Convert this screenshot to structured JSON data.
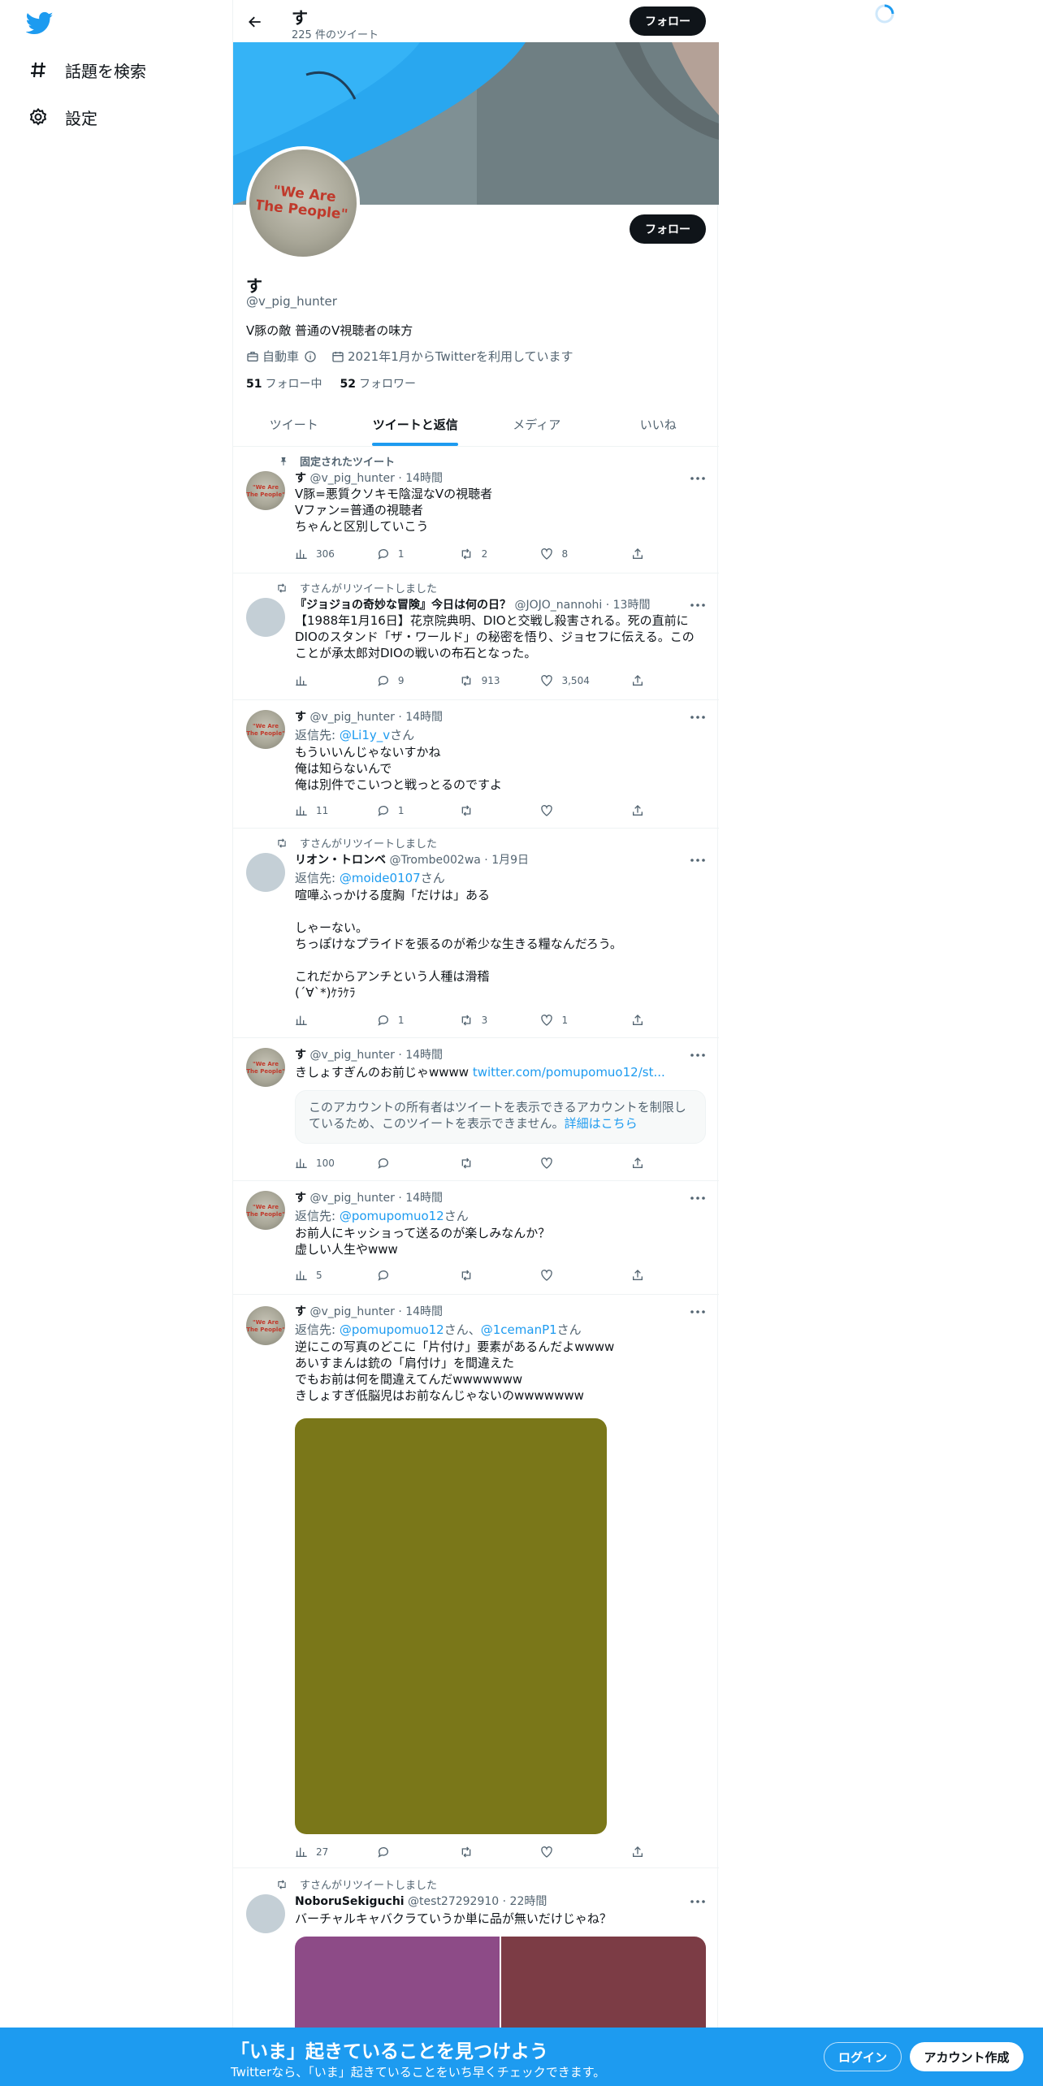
{
  "nav": {
    "logo_icon": "twitter-bird-icon",
    "explore_label": "話題を検索",
    "settings_label": "設定"
  },
  "header": {
    "title": "す",
    "tweet_count": "225 件のツイート",
    "follow_label": "フォロー"
  },
  "profile": {
    "name": "す",
    "handle": "@v_pig_hunter",
    "bio": "V豚の敵 普通のV視聴者の味方",
    "category": "自動車",
    "joined": "2021年1月からTwitterを利用しています",
    "following_count": "51",
    "following_label": "フォロー中",
    "followers_count": "52",
    "followers_label": "フォロワー",
    "follow_label": "フォロー"
  },
  "tabs": [
    "ツイート",
    "ツイートと返信",
    "メディア",
    "いいね"
  ],
  "tweets": [
    {
      "context": "固定されたツイート",
      "name": "す",
      "meta": "@v_pig_hunter · 14時間",
      "body": "V豚=悪質クソキモ陰湿なVの視聴者\nVファン=普通の視聴者\nちゃんと区別していこう",
      "views": "306",
      "replies": "1",
      "retweets": "2",
      "likes": "8"
    },
    {
      "context": "すさんがリツイートしました",
      "name": "『ジョジョの奇妙な冒険』今日は何の日？",
      "meta": "@JOJO_nannohi · 13時間",
      "body": "【1988年1月16日】花京院典明、DIOと交戦し殺害される。死の直前にDIOのスタンド「ザ・ワールド」の秘密を悟り、ジョセフに伝える。このことが承太郎対DIOの戦いの布石となった。",
      "views": "",
      "replies": "9",
      "retweets": "913",
      "likes": "3,504"
    },
    {
      "name": "す",
      "meta": "@v_pig_hunter · 14時間",
      "reply_prefix": "返信先: ",
      "reply_to": "@Li1y_v",
      "reply_suffix": "さん",
      "body": "もういいんじゃないすかね\n俺は知らないんで\n俺は別件でこいつと戦っとるのですよ",
      "views": "11",
      "replies": "1",
      "retweets": "",
      "likes": ""
    },
    {
      "context": "すさんがリツイートしました",
      "name": "リオン・トロンベ",
      "meta": "@Trombe002wa · 1月9日",
      "reply_prefix": "返信先: ",
      "reply_to": "@moide0107",
      "reply_suffix": "さん",
      "body": "喧嘩ふっかける度胸「だけは」ある\n\nしゃーない。\nちっぽけなプライドを張るのが希少な生きる糧なんだろう。\n\nこれだからアンチという人種は滑稽\n(´∀`*)ｹﾗｹﾗ",
      "views": "",
      "replies": "1",
      "retweets": "3",
      "likes": "1"
    },
    {
      "name": "す",
      "meta": "@v_pig_hunter · 14時間",
      "body_text": "きしょすぎんのお前じゃwwww ",
      "body_link": "twitter.com/pomupomuo12/st...",
      "notice_text": "このアカウントの所有者はツイートを表示できるアカウントを制限しているため、このツイートを表示できません。",
      "notice_link": "詳細はこちら",
      "views": "100",
      "replies": "",
      "retweets": "",
      "likes": ""
    },
    {
      "name": "す",
      "meta": "@v_pig_hunter · 14時間",
      "reply_prefix": "返信先: ",
      "reply_to": "@pomupomuo12",
      "reply_suffix": "さん",
      "body": "お前人にキッショって送るのが楽しみなんか？\n虚しい人生やwww",
      "views": "5",
      "replies": "",
      "retweets": "",
      "likes": ""
    },
    {
      "name": "す",
      "meta": "@v_pig_hunter · 14時間",
      "reply_prefix": "返信先: ",
      "reply_to": "@pomupomuo12",
      "reply_mid": "さん、",
      "reply_to2": "@1cemanP1",
      "reply_suffix": "さん",
      "body": "逆にこの写真のどこに「片付け」要素があるんだよwwww\nあいすまんは銃の「肩付け」を間違えた\nでもお前は何を間違えてんだwwwwwww\nきしょすぎ低脳児はお前なんじゃないのwwwwwww",
      "views": "27",
      "replies": "",
      "retweets": "",
      "likes": ""
    },
    {
      "context": "すさんがリツイートしました",
      "name": "NoboruSekiguchi",
      "meta": "@test27292910 · 22時間",
      "body": "バーチャルキャバクラていうか単に品が無いだけじゃね？"
    }
  ],
  "bottom": {
    "title": "「いま」起きていることを見つけよう",
    "subtitle": "Twitterなら、「いま」起きていることをいち早くチェックできます。",
    "login": "ログイン",
    "signup": "アカウント作成"
  },
  "colors": {
    "accent": "#1d9bf0",
    "dark": "#0f1419",
    "muted": "#536471"
  }
}
